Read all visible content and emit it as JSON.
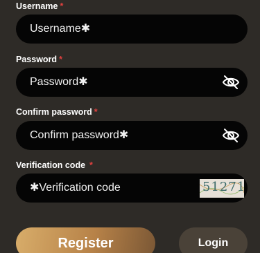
{
  "form": {
    "username": {
      "label": "Username",
      "required_mark": "*",
      "placeholder": "Username✱"
    },
    "password": {
      "label": "Password",
      "required_mark": "*",
      "placeholder": "Password✱",
      "toggle_icon": "eye-slash-icon"
    },
    "confirm_password": {
      "label": "Confirm password",
      "required_mark": "*",
      "placeholder": "Confirm password✱",
      "toggle_icon": "eye-slash-icon"
    },
    "verification_code": {
      "label": "Verification code",
      "required_mark": "*",
      "placeholder": "✱Verification code",
      "captcha_text": "51271"
    }
  },
  "actions": {
    "register_label": "Register",
    "login_label": "Login"
  },
  "colors": {
    "background": "#2e2b27",
    "input_background": "#050505",
    "required": "#e0413f",
    "register_gradient_start": "#d8ad6a",
    "register_gradient_end": "#7a5735",
    "login_background": "#4a4238"
  }
}
